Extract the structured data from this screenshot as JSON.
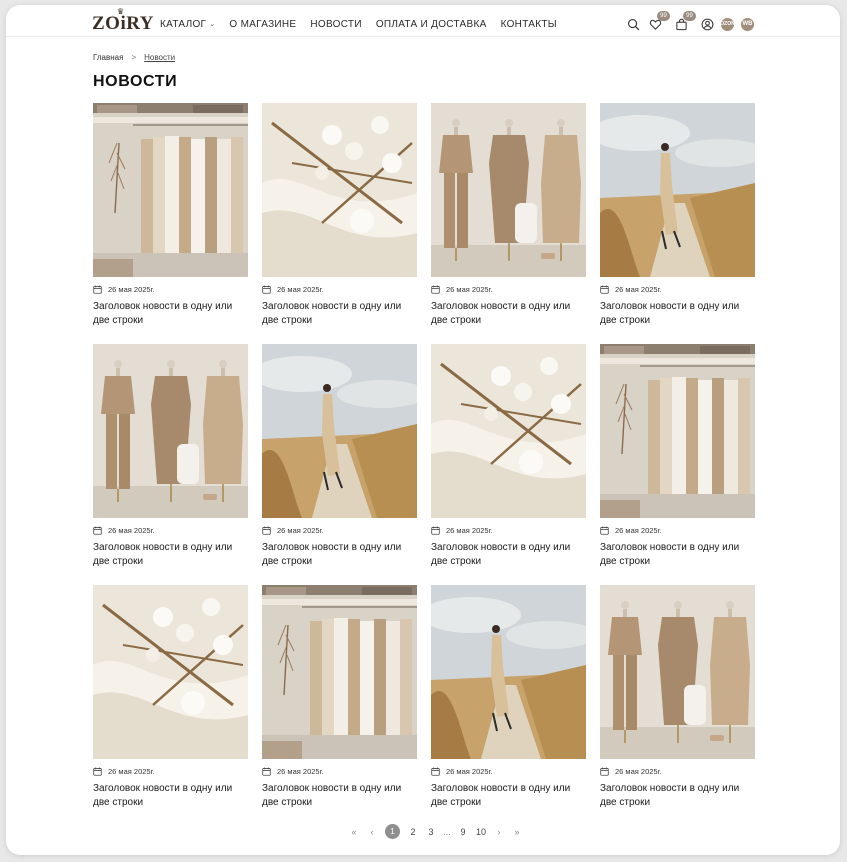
{
  "header": {
    "logo": "ZOiRY",
    "nav": [
      {
        "label": "КАТАЛОГ",
        "has_dropdown": true
      },
      {
        "label": "О МАГАЗИНЕ"
      },
      {
        "label": "НОВОСТИ"
      },
      {
        "label": "ОПЛАТА И ДОСТАВКА"
      },
      {
        "label": "КОНТАКТЫ"
      }
    ],
    "favorites_count": "99",
    "cart_count": "99",
    "ozon_label": "OZON",
    "wb_label": "WB",
    "icons": [
      "search-icon",
      "heart-icon",
      "bag-icon",
      "user-icon"
    ]
  },
  "breadcrumb": {
    "home": "Главная",
    "separator": ">",
    "current": "Новости"
  },
  "page": {
    "title": "НОВОСТИ"
  },
  "news": [
    {
      "image": "wardrobe",
      "date": "26 мая 2025г.",
      "title": "Заголовок новости в одну или две строки"
    },
    {
      "image": "cotton",
      "date": "26 мая 2025г.",
      "title": "Заголовок новости в одну или две строки"
    },
    {
      "image": "mannequins",
      "date": "26 мая 2025г.",
      "title": "Заголовок новости в одну или две строки"
    },
    {
      "image": "field",
      "date": "26 мая 2025г.",
      "title": "Заголовок новости в одну или две строки"
    },
    {
      "image": "mannequins",
      "date": "26 мая 2025г.",
      "title": "Заголовок новости в одну или две строки"
    },
    {
      "image": "field",
      "date": "26 мая 2025г.",
      "title": "Заголовок новости в одну или две строки"
    },
    {
      "image": "cotton",
      "date": "26 мая 2025г.",
      "title": "Заголовок новости в одну или две строки"
    },
    {
      "image": "wardrobe",
      "date": "26 мая 2025г.",
      "title": "Заголовок новости в одну или две строки"
    },
    {
      "image": "cotton",
      "date": "26 мая 2025г.",
      "title": "Заголовок новости в одну или две строки"
    },
    {
      "image": "wardrobe",
      "date": "26 мая 2025г.",
      "title": "Заголовок новости в одну или две строки"
    },
    {
      "image": "field",
      "date": "26 мая 2025г.",
      "title": "Заголовок новости в одну или две строки"
    },
    {
      "image": "mannequins",
      "date": "26 мая 2025г.",
      "title": "Заголовок новости в одну или две строки"
    }
  ],
  "pagination": {
    "first": "«",
    "prev": "‹",
    "pages": [
      "1",
      "2",
      "3"
    ],
    "ellipsis": "...",
    "tail_pages": [
      "9",
      "10"
    ],
    "next": "›",
    "last": "»",
    "current": "1"
  },
  "colors": {
    "accent": "#a08d7a",
    "badge": "#9a8c80",
    "pagination_active": "#8f8f8f"
  }
}
